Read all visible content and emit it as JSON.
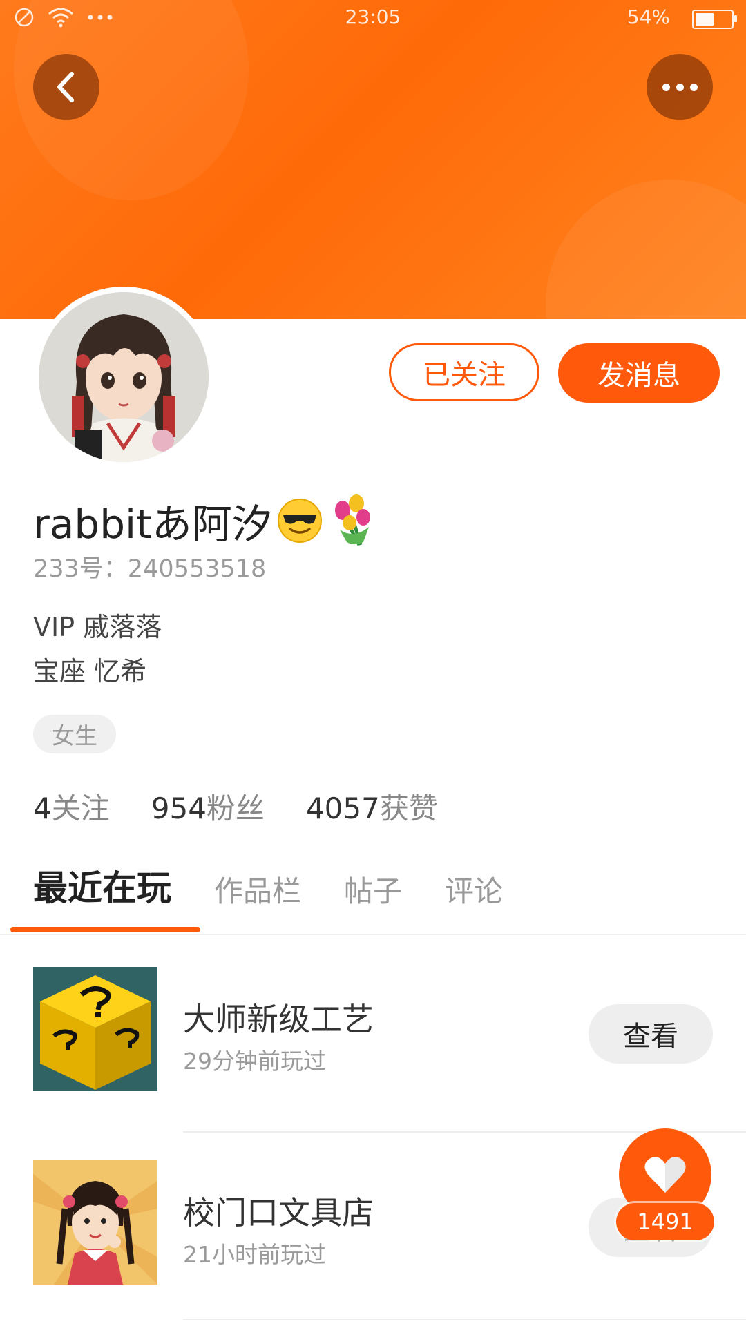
{
  "status_bar": {
    "time": "23:05",
    "battery_percent": "54%",
    "battery_level": 0.54
  },
  "profile": {
    "nickname": "rabbitあ阿汐",
    "emoji_icons": [
      "smiling-face-with-sunglasses",
      "bouquet"
    ],
    "id_line": "233号：240553518",
    "bio_lines": [
      "VIP 戚落落",
      "宝座 忆希"
    ],
    "gender_tag": "女生",
    "follow_button": "已关注",
    "message_button": "发消息",
    "stats": [
      {
        "value": "4",
        "label": "关注"
      },
      {
        "value": "954",
        "label": "粉丝"
      },
      {
        "value": "4057",
        "label": "获赞"
      }
    ]
  },
  "tabs": [
    {
      "label": "最近在玩",
      "active": true
    },
    {
      "label": "作品栏",
      "active": false
    },
    {
      "label": "帖子",
      "active": false
    },
    {
      "label": "评论",
      "active": false
    }
  ],
  "games": [
    {
      "title": "大师新级工艺",
      "played": "29分钟前玩过",
      "button": "查看",
      "thumb_icon": "lucky-block-icon"
    },
    {
      "title": "校门口文具店",
      "played": "21小时前玩过",
      "button": "查看",
      "thumb_icon": "girl-character-icon"
    }
  ],
  "like": {
    "count": "1491"
  },
  "colors": {
    "accent": "#ff5a0c",
    "banner": "#ff7a1c"
  }
}
